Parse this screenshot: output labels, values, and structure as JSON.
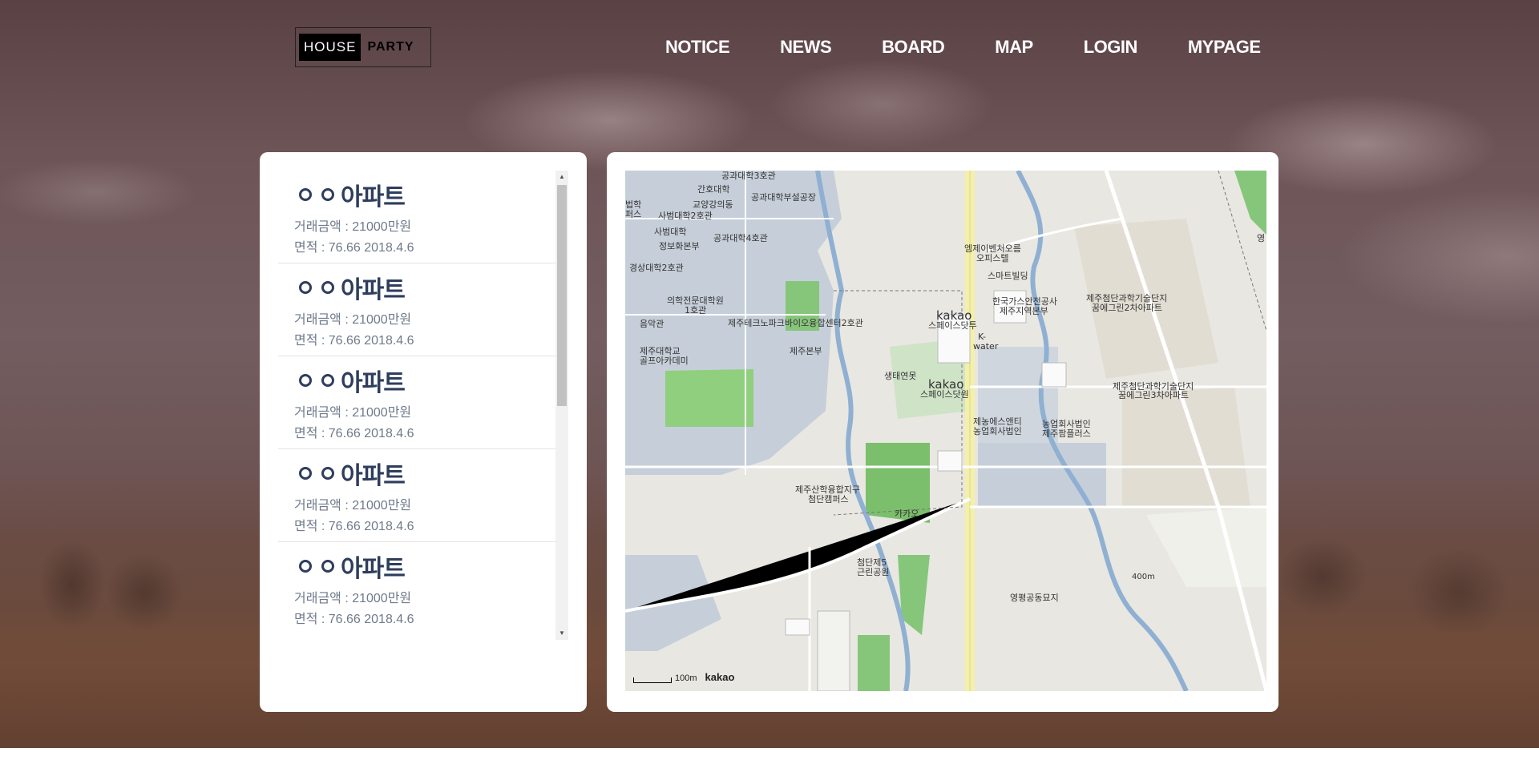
{
  "logo": {
    "left": "HOUSE",
    "right": "PARTY"
  },
  "nav": {
    "items": [
      "NOTICE",
      "NEWS",
      "BOARD",
      "MAP",
      "LOGIN",
      "MYPAGE"
    ]
  },
  "listings": [
    {
      "name": "아파트",
      "price": "거래금액 : 21000만원",
      "area": "면적 : 76.66 2018.4.6"
    },
    {
      "name": "아파트",
      "price": "거래금액 : 21000만원",
      "area": "면적 : 76.66 2018.4.6"
    },
    {
      "name": "아파트",
      "price": "거래금액 : 21000만원",
      "area": "면적 : 76.66 2018.4.6"
    },
    {
      "name": "아파트",
      "price": "거래금액 : 21000만원",
      "area": "면적 : 76.66 2018.4.6"
    },
    {
      "name": "아파트",
      "price": "거래금액 : 21000만원",
      "area": "면적 : 76.66 2018.4.6"
    }
  ],
  "map": {
    "labels": {
      "l1": "공과대학3호관",
      "l2": "간호대학",
      "l3": "공과대학부설공장",
      "l4": "교양강의동",
      "l5": "법학",
      "l6": "퍼스",
      "l7": "사범대학2호관",
      "l8": "사범대학",
      "l9": "공과대학4호관",
      "l10": "정보화본부",
      "l11": "경상대학2호관",
      "l12": "의학전문대학원",
      "l13": "1호관",
      "l14": "제주테크노파크바이오융합센터2호관",
      "l15": "음악관",
      "l16": "제주대학교",
      "l17": "골프아카데미",
      "l18": "제주본부",
      "l19": "생태연못",
      "l20": "엠제이벤처오름",
      "l21": "오피스텔",
      "l22": "스마트빌딩",
      "l23": "한국가스안전공사",
      "l24": "제주지역본부",
      "l25": "kakao",
      "l26": "스페이스닷투",
      "l27": "K-",
      "l28": "water",
      "l29": "kakao",
      "l30": "스페이스닷원",
      "l31": "제주첨단과학기술단지",
      "l32": "꿈에그린2차아파트",
      "l33": "제주첨단과학기술단지",
      "l34": "꿈에그린3차아파트",
      "l35": "제농에스앤티",
      "l36": "농업회사법인",
      "l37": "농업회사법인",
      "l38": "제주팜플러스",
      "l39": "제주산학융합지구",
      "l40": "첨단캠퍼스",
      "l41": "카카오",
      "l42": "첨단제5",
      "l43": "근린공원",
      "l44": "400m",
      "l45": "영평공동묘지",
      "l46": "영"
    },
    "scale_label": "100m",
    "brand": "kakao"
  }
}
